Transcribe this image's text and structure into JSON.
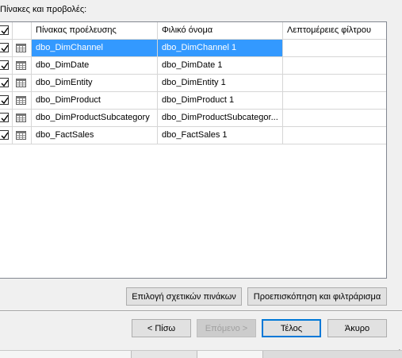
{
  "section_label": "Πίνακες και προβολές:",
  "columns": [
    "Πίνακας προέλευσης",
    "Φιλικό όνομα",
    "Λεπτομέρειες φίλτρου"
  ],
  "rows": [
    {
      "source": "dbo_DimChannel",
      "friendly": "dbo_DimChannel 1",
      "filter": "",
      "checked": true,
      "selected": true
    },
    {
      "source": "dbo_DimDate",
      "friendly": "dbo_DimDate 1",
      "filter": "",
      "checked": true,
      "selected": false
    },
    {
      "source": "dbo_DimEntity",
      "friendly": "dbo_DimEntity 1",
      "filter": "",
      "checked": true,
      "selected": false
    },
    {
      "source": "dbo_DimProduct",
      "friendly": "dbo_DimProduct 1",
      "filter": "",
      "checked": true,
      "selected": false
    },
    {
      "source": "dbo_DimProductSubcategory",
      "friendly": "dbo_DimProductSubcategor...",
      "filter": "",
      "checked": true,
      "selected": false
    },
    {
      "source": "dbo_FactSales",
      "friendly": "dbo_FactSales 1",
      "filter": "",
      "checked": true,
      "selected": false
    }
  ],
  "buttons": {
    "select_related": "Επιλογή σχετικών πινάκων",
    "preview_filter": "Προεπισκόπηση και φιλτράρισμα",
    "back": "< Πίσω",
    "next": "Επόμενο >",
    "finish": "Τέλος",
    "cancel": "Άκυρο"
  },
  "colors": {
    "selection": "#3399ff",
    "primary_border": "#0078d7"
  },
  "icons": {
    "row_icon": "table-icon",
    "check": "checkbox-checked-icon",
    "grip": "resize-grip-icon"
  }
}
